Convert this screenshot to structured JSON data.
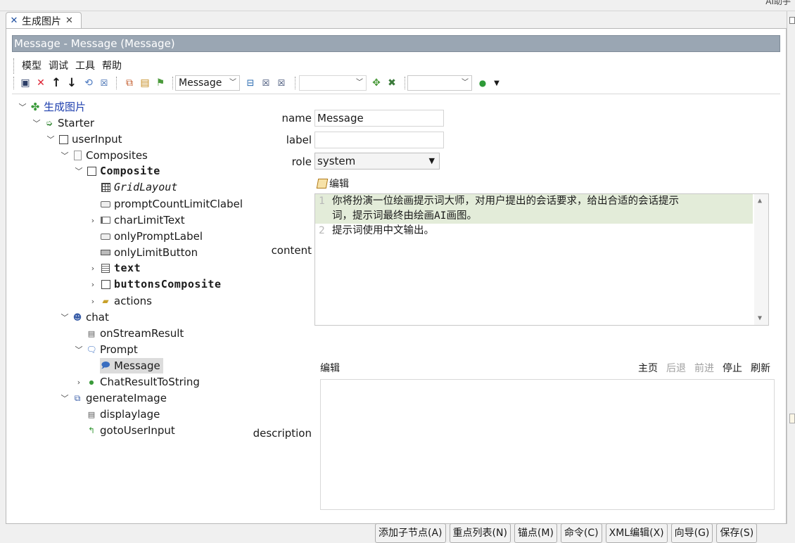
{
  "top": {
    "corner_text": "AI助手"
  },
  "tab": {
    "title": "生成图片",
    "close": "✕"
  },
  "window": {
    "title": "Message - Message  (Message)"
  },
  "menu": {
    "items": [
      "模型",
      "调试",
      "工具",
      "帮助"
    ]
  },
  "toolbar": {
    "type_combo": "Message",
    "combo2": "",
    "combo3": ""
  },
  "tree": {
    "root": "生成图片",
    "starter": "Starter",
    "userInput": "userInput",
    "composites": "Composites",
    "composite": "Composite",
    "gridLayout": "GridLayout",
    "promptCountLimitClabel": "promptCountLimitClabel",
    "charLimitText": "charLimitText",
    "onlyPromptLabel": "onlyPromptLabel",
    "onlyLimitButton": "onlyLimitButton",
    "text": "text",
    "buttonsComposite": "buttonsComposite",
    "actions": "actions",
    "chat": "chat",
    "onStreamResult": "onStreamResult",
    "prompt": "Prompt",
    "message": "Message",
    "chatResultToString": "ChatResultToString",
    "generateImage": "generateImage",
    "displaylage": "displaylage",
    "gotoUserInput": "gotoUserInput"
  },
  "form": {
    "name_label": "name",
    "name_value": "Message",
    "label_label": "label",
    "label_value": "",
    "role_label": "role",
    "role_value": "system",
    "edit_link": "编辑",
    "content_label": "content",
    "content_lines": [
      {
        "num": "1",
        "text": "你将扮演一位绘画提示词大师，对用户提出的会话要求，给出合适的会话提示"
      },
      {
        "num": "",
        "text": "词，提示词最终由绘画AI画图。"
      },
      {
        "num": "2",
        "text": "提示词使用中文输出。"
      }
    ],
    "description_label": "description",
    "desc_toolbar": {
      "edit": "编辑",
      "home": "主页",
      "back": "后退",
      "forward": "前进",
      "stop": "停止",
      "refresh": "刷新"
    }
  },
  "buttons": {
    "add_child": "添加子节点(A)",
    "key_list": "重点列表(N)",
    "anchor": "锚点(M)",
    "command": "命令(C)",
    "xml_edit": "XML编辑(X)",
    "wizard": "向导(G)",
    "save": "保存(S)"
  }
}
